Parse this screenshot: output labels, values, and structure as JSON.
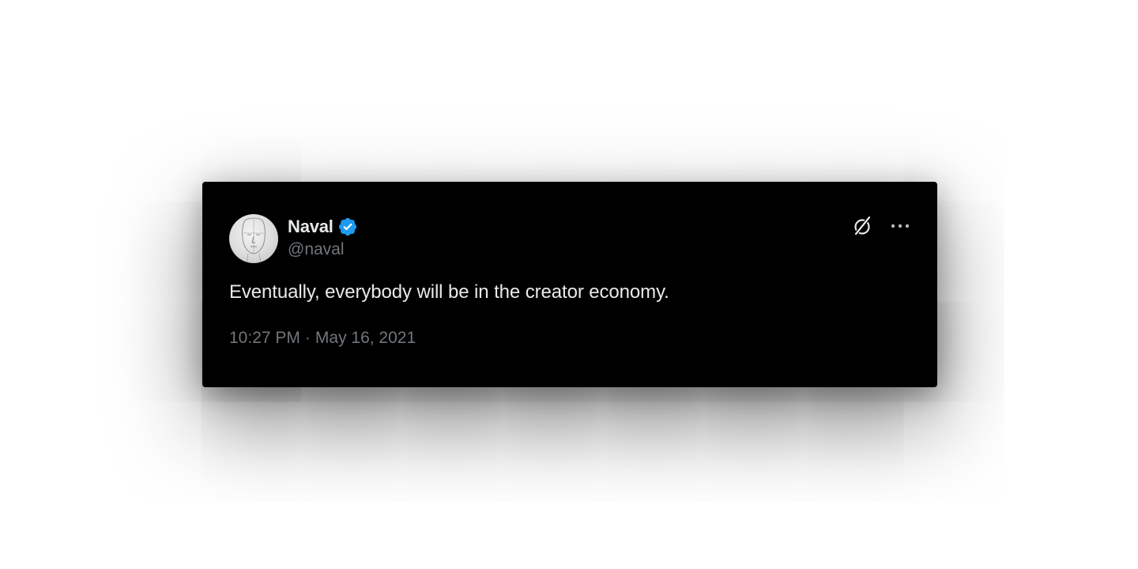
{
  "tweet": {
    "display_name": "Naval",
    "handle": "@naval",
    "verified": true,
    "text": "Eventually, everybody will be in the creator economy.",
    "time": "10:27 PM",
    "separator": "·",
    "date": "May 16, 2021"
  },
  "icons": {
    "avatar": "sketch-portrait-avatar",
    "verified": "verified-badge-icon",
    "grok": "grok-icon",
    "more": "more-options-icon"
  },
  "colors": {
    "card_background": "#000000",
    "primary_text": "#e7e9ea",
    "secondary_text": "#71767b",
    "verified_blue": "#1d9bf0",
    "page_background": "#ffffff"
  }
}
